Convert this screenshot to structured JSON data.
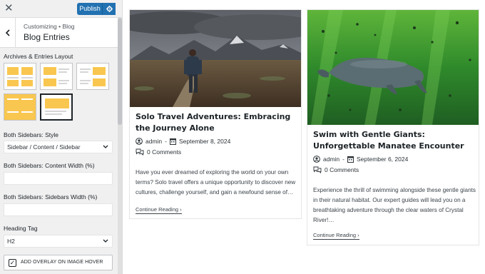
{
  "topbar": {
    "publish_label": "Publish"
  },
  "section": {
    "breadcrumb": "Customizing • Blog",
    "title": "Blog Entries"
  },
  "controls": {
    "layout_label": "Archives & Entries Layout",
    "layouts": [
      "grid-layout",
      "list-layout",
      "list-alt-layout",
      "grid-alt-layout",
      "boxed-layout"
    ],
    "selected_layout_index": 4,
    "style_label": "Both Sidebars: Style",
    "style_value": "Sidebar / Content / Sidebar",
    "content_width_label": "Both Sidebars: Content Width (%)",
    "sidebars_width_label": "Both Sidebars: Sidebars Width (%)",
    "heading_tag_label": "Heading Tag",
    "heading_tag_value": "H2",
    "overlay_label": "ADD OVERLAY ON IMAGE HOVER",
    "overlay_checked": true
  },
  "posts": [
    {
      "title": "Solo Travel Adventures: Embracing the Journey Alone",
      "author": "admin",
      "date": "September 8, 2024",
      "comments": "0 Comments",
      "excerpt": "Have you ever dreamed of exploring the world on your own terms? Solo travel offers a unique opportunity to discover new cultures, challenge yourself, and gain a newfound sense of…",
      "link": "Continue Reading"
    },
    {
      "title": "Swim with Gentle Giants: Unforgettable Manatee Encounter",
      "author": "admin",
      "date": "September 6, 2024",
      "comments": "0 Comments",
      "excerpt": "Experience the thrill of swimming alongside these gentle giants in their natural habitat. Our expert guides will lead you on a breathtaking adventure through the clear waters of Crystal River!…",
      "link": "Continue Reading"
    }
  ]
}
